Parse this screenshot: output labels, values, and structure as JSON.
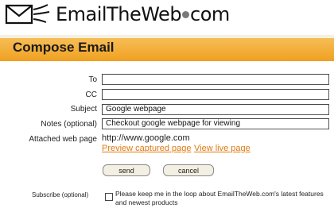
{
  "brand": {
    "logo_text_prefix": "EmailTheWeb",
    "logo_text_suffix": "com",
    "icon": "envelope-icon"
  },
  "header": {
    "title": "Compose Email",
    "colors": {
      "bar_top": "#f7c25f",
      "bar_bottom": "#f0a020"
    }
  },
  "form": {
    "to": {
      "label": "To",
      "value": ""
    },
    "cc": {
      "label": "CC",
      "value": ""
    },
    "subject": {
      "label": "Subject",
      "value": "Google webpage"
    },
    "notes": {
      "label": "Notes (optional)",
      "value": "Checkout google webpage for viewing"
    },
    "attached": {
      "label": "Attached web page",
      "url": "http://www.google.com",
      "preview_link": "Preview captured page",
      "live_link": "View live page"
    },
    "send_label": "send",
    "cancel_label": "cancel",
    "subscribe": {
      "label": "Subscribe (optional)",
      "text": "Please keep me in the loop about EmailTheWeb.com's latest features and newest products",
      "checked": false
    }
  },
  "colors": {
    "link": "#e07a10"
  }
}
